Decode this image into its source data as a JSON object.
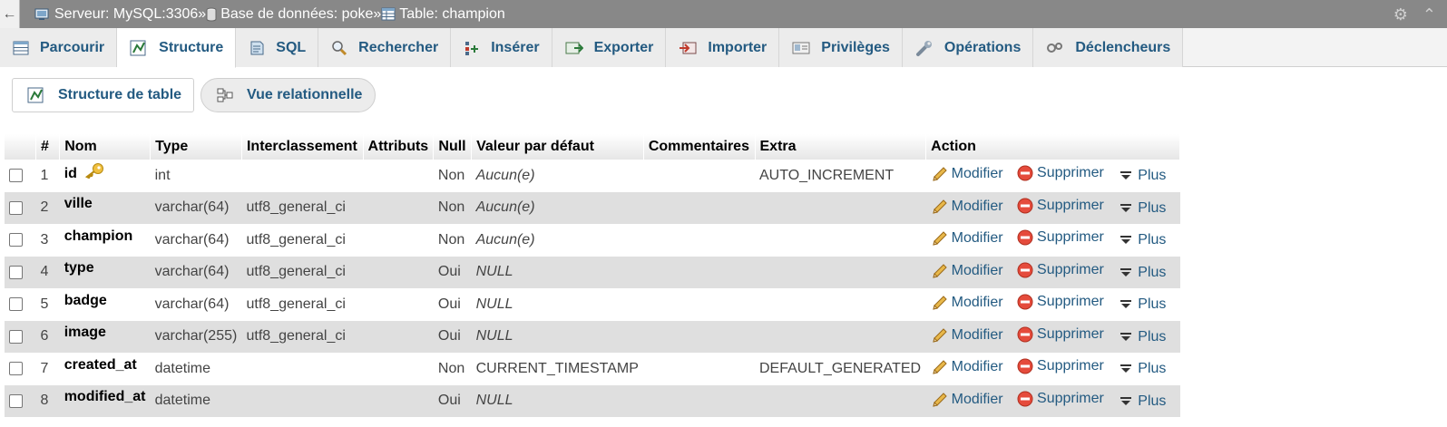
{
  "breadcrumb": {
    "server": "Serveur: MySQL:3306",
    "database": "Base de données: poke",
    "table": "Table: champion",
    "separator": "»"
  },
  "tabs": [
    {
      "label": "Parcourir"
    },
    {
      "label": "Structure"
    },
    {
      "label": "SQL"
    },
    {
      "label": "Rechercher"
    },
    {
      "label": "Insérer"
    },
    {
      "label": "Exporter"
    },
    {
      "label": "Importer"
    },
    {
      "label": "Privilèges"
    },
    {
      "label": "Opérations"
    },
    {
      "label": "Déclencheurs"
    }
  ],
  "subnav": {
    "structure_label": "Structure de table",
    "relation_label": "Vue relationnelle"
  },
  "columns": [
    "#",
    "Nom",
    "Type",
    "Interclassement",
    "Attributs",
    "Null",
    "Valeur par défaut",
    "Commentaires",
    "Extra",
    "Action"
  ],
  "actions": {
    "modify": "Modifier",
    "delete": "Supprimer",
    "more": "Plus"
  },
  "rows": [
    {
      "num": "1",
      "name": "id",
      "type": "int",
      "collation": "",
      "null": "Non",
      "default": "Aucun(e)",
      "extra": "AUTO_INCREMENT"
    },
    {
      "num": "2",
      "name": "ville",
      "type": "varchar(64)",
      "collation": "utf8_general_ci",
      "null": "Non",
      "default": "Aucun(e)",
      "extra": ""
    },
    {
      "num": "3",
      "name": "champion",
      "type": "varchar(64)",
      "collation": "utf8_general_ci",
      "null": "Non",
      "default": "Aucun(e)",
      "extra": ""
    },
    {
      "num": "4",
      "name": "type",
      "type": "varchar(64)",
      "collation": "utf8_general_ci",
      "null": "Oui",
      "default": "NULL",
      "extra": ""
    },
    {
      "num": "5",
      "name": "badge",
      "type": "varchar(64)",
      "collation": "utf8_general_ci",
      "null": "Oui",
      "default": "NULL",
      "extra": ""
    },
    {
      "num": "6",
      "name": "image",
      "type": "varchar(255)",
      "collation": "utf8_general_ci",
      "null": "Oui",
      "default": "NULL",
      "extra": ""
    },
    {
      "num": "7",
      "name": "created_at",
      "type": "datetime",
      "collation": "",
      "null": "Non",
      "default": "CURRENT_TIMESTAMP",
      "extra": "DEFAULT_GENERATED"
    },
    {
      "num": "8",
      "name": "modified_at",
      "type": "datetime",
      "collation": "",
      "null": "Oui",
      "default": "NULL",
      "extra": ""
    }
  ]
}
